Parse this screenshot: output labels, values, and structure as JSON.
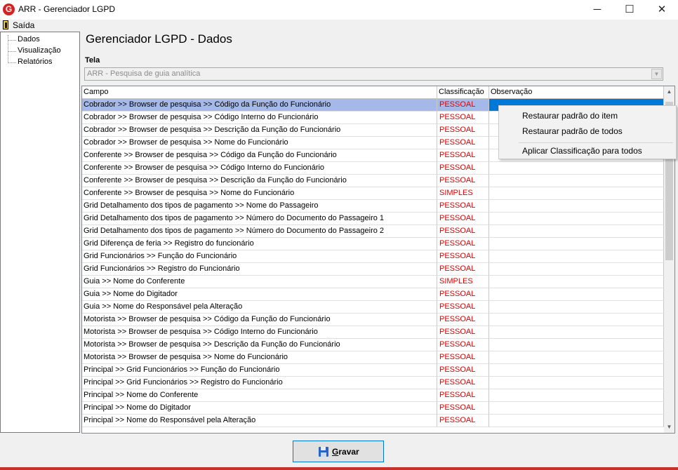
{
  "window": {
    "title": "ARR - Gerenciador LGPD",
    "app_icon_letter": "G",
    "controls": {
      "minimize": "─",
      "maximize": "☐",
      "close": "✕"
    }
  },
  "menubar": {
    "exit_label": "Saída",
    "exit_icon": "exit-door-icon"
  },
  "tree": {
    "items": [
      "Dados",
      "Visualização",
      "Relatórios"
    ]
  },
  "page": {
    "title": "Gerenciador LGPD - Dados"
  },
  "tela": {
    "label": "Tela",
    "selected": "ARR - Pesquisa de guia analítica"
  },
  "grid": {
    "columns": [
      "Campo",
      "Classificação",
      "Observação"
    ],
    "selected_row": 0,
    "rows": [
      {
        "campo": "Cobrador >> Browser de pesquisa >> Código da Função do Funcionário",
        "classificacao": "PESSOAL",
        "observacao": ""
      },
      {
        "campo": "Cobrador >> Browser de pesquisa >> Código Interno do Funcionário",
        "classificacao": "PESSOAL",
        "observacao": ""
      },
      {
        "campo": "Cobrador >> Browser de pesquisa >> Descrição da Função do Funcionário",
        "classificacao": "PESSOAL",
        "observacao": ""
      },
      {
        "campo": "Cobrador >> Browser de pesquisa >> Nome do Funcionário",
        "classificacao": "PESSOAL",
        "observacao": ""
      },
      {
        "campo": "Conferente >> Browser de pesquisa >> Código da Função do Funcionário",
        "classificacao": "PESSOAL",
        "observacao": ""
      },
      {
        "campo": "Conferente >> Browser de pesquisa >> Código Interno do Funcionário",
        "classificacao": "PESSOAL",
        "observacao": ""
      },
      {
        "campo": "Conferente >> Browser de pesquisa >> Descrição da Função do Funcionário",
        "classificacao": "PESSOAL",
        "observacao": ""
      },
      {
        "campo": "Conferente >> Browser de pesquisa >> Nome do Funcionário",
        "classificacao": "SIMPLES",
        "observacao": ""
      },
      {
        "campo": "Grid Detalhamento dos tipos de pagamento >> Nome do Passageiro",
        "classificacao": "PESSOAL",
        "observacao": ""
      },
      {
        "campo": "Grid Detalhamento dos tipos de pagamento >> Número do Documento do Passageiro 1",
        "classificacao": "PESSOAL",
        "observacao": ""
      },
      {
        "campo": "Grid Detalhamento dos tipos de pagamento >> Número do Documento do Passageiro 2",
        "classificacao": "PESSOAL",
        "observacao": ""
      },
      {
        "campo": "Grid Diferença de feria >> Registro do funcionário",
        "classificacao": "PESSOAL",
        "observacao": ""
      },
      {
        "campo": "Grid Funcionários >> Função do Funcionário",
        "classificacao": "PESSOAL",
        "observacao": ""
      },
      {
        "campo": "Grid Funcionários >> Registro do Funcionário",
        "classificacao": "PESSOAL",
        "observacao": ""
      },
      {
        "campo": "Guia >> Nome do Conferente",
        "classificacao": "SIMPLES",
        "observacao": ""
      },
      {
        "campo": "Guia >> Nome do Digitador",
        "classificacao": "PESSOAL",
        "observacao": ""
      },
      {
        "campo": "Guia >> Nome do Responsável pela Alteração",
        "classificacao": "PESSOAL",
        "observacao": ""
      },
      {
        "campo": "Motorista >> Browser de pesquisa >> Código da Função do Funcionário",
        "classificacao": "PESSOAL",
        "observacao": ""
      },
      {
        "campo": "Motorista >> Browser de pesquisa >> Código Interno do Funcionário",
        "classificacao": "PESSOAL",
        "observacao": ""
      },
      {
        "campo": "Motorista >> Browser de pesquisa >> Descrição da Função do Funcionário",
        "classificacao": "PESSOAL",
        "observacao": ""
      },
      {
        "campo": "Motorista >> Browser de pesquisa >> Nome do Funcionário",
        "classificacao": "PESSOAL",
        "observacao": ""
      },
      {
        "campo": "Principal >> Grid Funcionários >> Função do Funcionário",
        "classificacao": "PESSOAL",
        "observacao": ""
      },
      {
        "campo": "Principal >> Grid Funcionários >> Registro do Funcionário",
        "classificacao": "PESSOAL",
        "observacao": ""
      },
      {
        "campo": "Principal >> Nome do Conferente",
        "classificacao": "PESSOAL",
        "observacao": ""
      },
      {
        "campo": "Principal >> Nome do Digitador",
        "classificacao": "PESSOAL",
        "observacao": ""
      },
      {
        "campo": "Principal >> Nome do Responsável pela Alteração",
        "classificacao": "PESSOAL",
        "observacao": ""
      }
    ]
  },
  "context_menu": {
    "items": [
      "Restaurar padrão do item",
      "Restaurar padrão de todos",
      "Aplicar Classificação para todos"
    ]
  },
  "save_button": {
    "label": "Gravar",
    "icon": "floppy-disk-icon"
  },
  "colors": {
    "classification_text": "#e00000",
    "selected_row": "#a5b9e8",
    "selected_cell": "#0078d7",
    "window_bottom_accent": "#c83030"
  }
}
